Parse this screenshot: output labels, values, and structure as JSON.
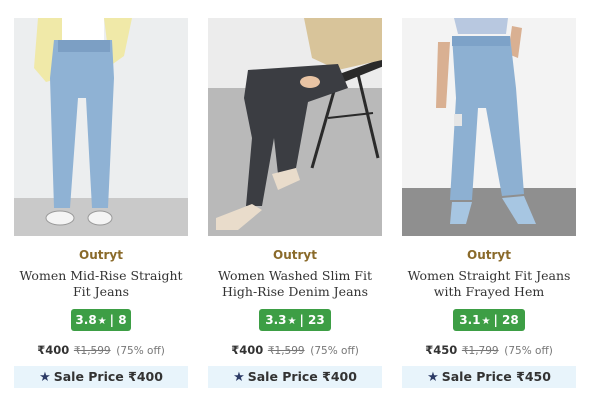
{
  "products": [
    {
      "brand": "Outryt",
      "title_line1": "Women Mid-Rise Straight",
      "title_line2": "Fit Jeans",
      "rating": "3.8",
      "reviews": "8",
      "price": "₹400",
      "mrp": "₹1,599",
      "discount": "(75% off)",
      "sale_label": "Sale Price ₹400",
      "image_icon": "jeans-model-standing-photo"
    },
    {
      "brand": "Outryt",
      "title_line1": "Women Washed Slim Fit",
      "title_line2": "High-Rise Denim Jeans",
      "rating": "3.3",
      "reviews": "23",
      "price": "₹400",
      "mrp": "₹1,599",
      "discount": "(75% off)",
      "sale_label": "Sale Price ₹400",
      "image_icon": "jeans-model-seated-photo"
    },
    {
      "brand": "Outryt",
      "title_line1": "Women Straight Fit Jeans",
      "title_line2": "with Frayed Hem",
      "rating": "3.1",
      "reviews": "28",
      "price": "₹450",
      "mrp": "₹1,799",
      "discount": "(75% off)",
      "sale_label": "Sale Price ₹450",
      "image_icon": "jeans-model-standing-photo"
    }
  ],
  "rating_star": "★",
  "rating_sep": "|",
  "sale_star": "★",
  "colors": {
    "rating_bg": "#3d9e45",
    "brand": "#8a6a2a",
    "sale_bg": "#e8f4fb",
    "sale_star": "#2c3b66"
  }
}
